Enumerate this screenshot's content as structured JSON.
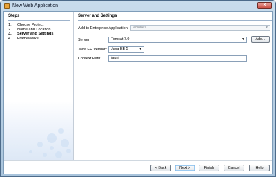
{
  "window": {
    "title": "New Web Application",
    "close_glyph": "✕"
  },
  "steps": {
    "heading": "Steps",
    "items": [
      {
        "num": "1.",
        "label": "Choose Project"
      },
      {
        "num": "2.",
        "label": "Name and Location"
      },
      {
        "num": "3.",
        "label": "Server and Settings",
        "current": true
      },
      {
        "num": "4.",
        "label": "Frameworks"
      }
    ]
  },
  "main": {
    "heading": "Server and Settings",
    "enterprise": {
      "label": "Add to Enterprise Application:",
      "value": "<None>"
    },
    "server": {
      "label": "Server:",
      "value": "Tomcat 7.0",
      "add_button": "Add..."
    },
    "java_ee": {
      "label": "Java EE Version:",
      "value": "Java EE 5"
    },
    "context_path": {
      "label": "Context Path:",
      "value": "/agni"
    }
  },
  "footer": {
    "back": "< Back",
    "next": "Next >",
    "finish": "Finish",
    "cancel": "Cancel",
    "help": "Help"
  },
  "icons": {
    "dropdown": "chevron-down-icon",
    "app": "netbeans-icon"
  }
}
